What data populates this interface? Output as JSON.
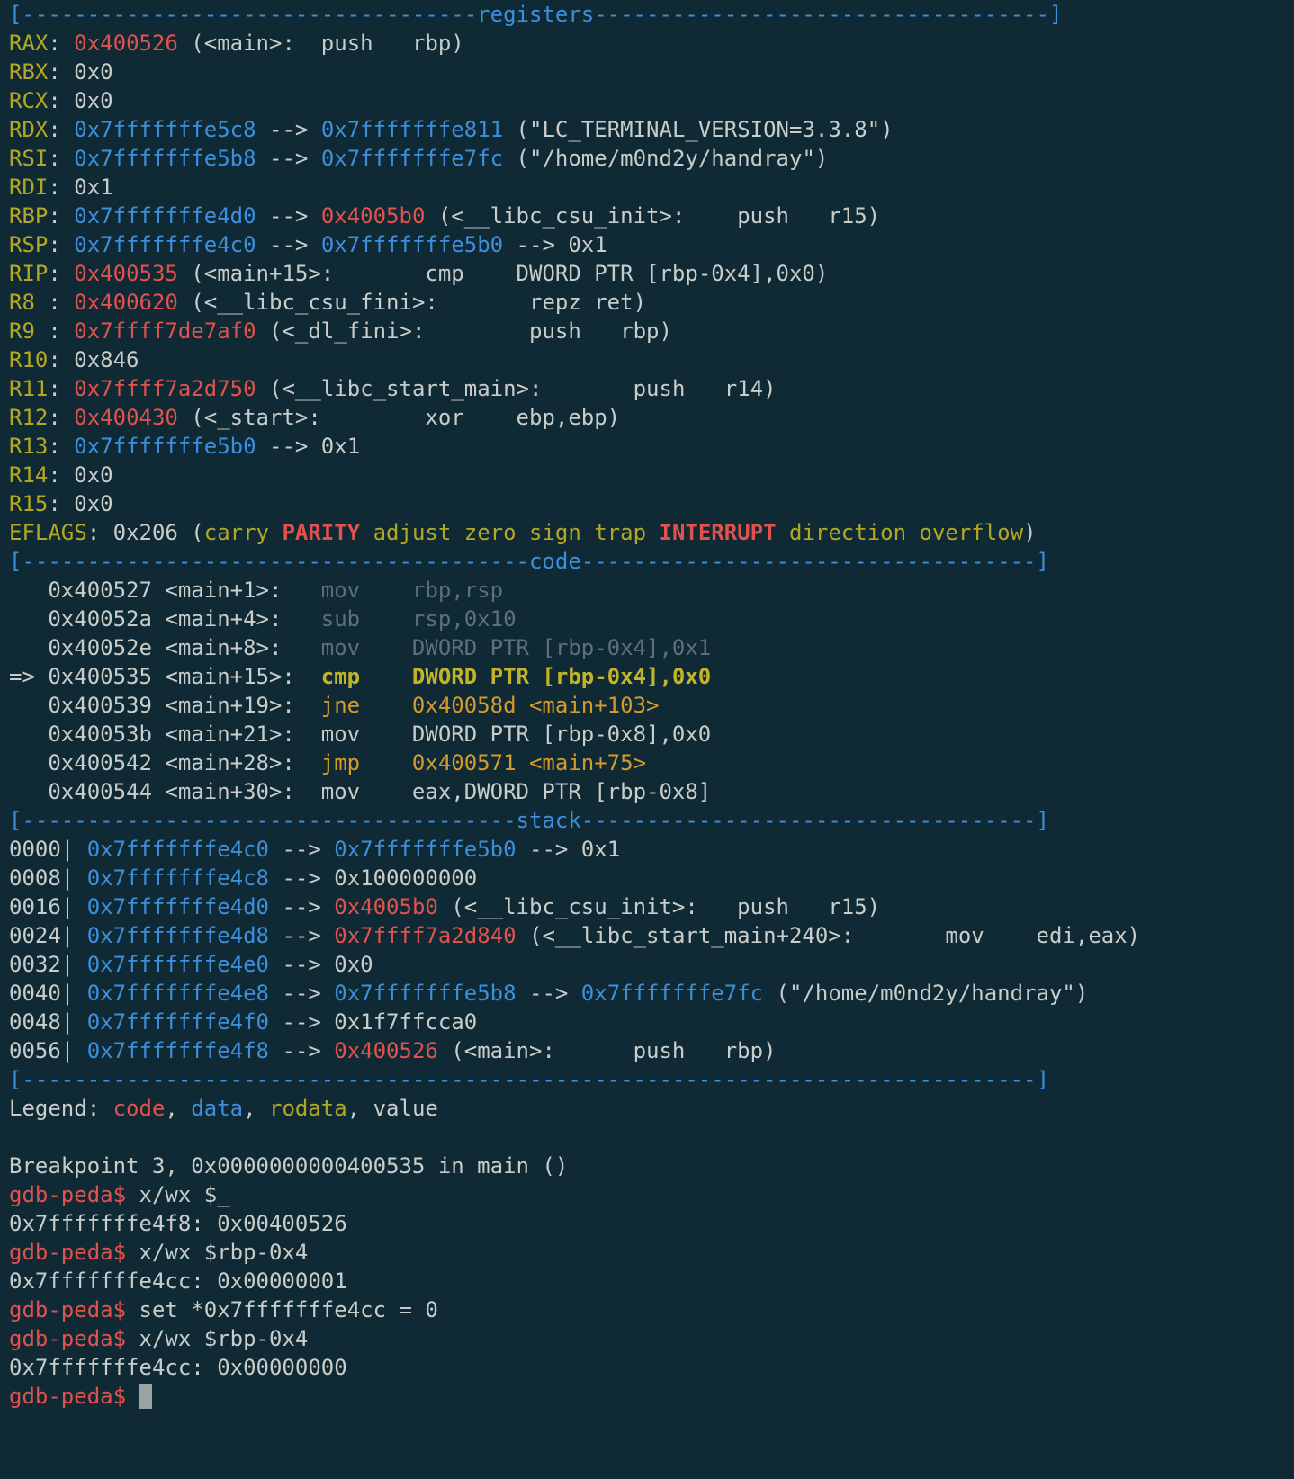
{
  "colors": {
    "background": "#0f2a35",
    "default": "#c9cdc9",
    "blue": "#3d8fdc",
    "red": "#e2524d",
    "yellow": "#b3a823",
    "orange": "#d49a2a",
    "dim": "#5c7178",
    "bright_yellow": "#c2b428",
    "cursor": "#9aa3a3"
  },
  "terminal": {
    "lines": [
      {
        "segs": [
          {
            "t": "[-----------------------------------",
            "c": "blue"
          },
          {
            "t": "registers",
            "c": "blue"
          },
          {
            "t": "-----------------------------------]",
            "c": "blue"
          }
        ]
      },
      {
        "segs": [
          {
            "t": "RAX",
            "c": "yellow"
          },
          {
            "t": ": ",
            "c": "default"
          },
          {
            "t": "0x400526",
            "c": "red"
          },
          {
            "t": " (<main>:  push   rbp)",
            "c": "default"
          }
        ]
      },
      {
        "segs": [
          {
            "t": "RBX",
            "c": "yellow"
          },
          {
            "t": ": 0x0",
            "c": "default"
          }
        ]
      },
      {
        "segs": [
          {
            "t": "RCX",
            "c": "yellow"
          },
          {
            "t": ": 0x0",
            "c": "default"
          }
        ]
      },
      {
        "segs": [
          {
            "t": "RDX",
            "c": "yellow"
          },
          {
            "t": ": ",
            "c": "default"
          },
          {
            "t": "0x7fffffffe5c8",
            "c": "blue"
          },
          {
            "t": " --> ",
            "c": "default"
          },
          {
            "t": "0x7fffffffe811",
            "c": "blue"
          },
          {
            "t": " (\"LC_TERMINAL_VERSION=3.3.8\")",
            "c": "default"
          }
        ]
      },
      {
        "segs": [
          {
            "t": "RSI",
            "c": "yellow"
          },
          {
            "t": ": ",
            "c": "default"
          },
          {
            "t": "0x7fffffffe5b8",
            "c": "blue"
          },
          {
            "t": " --> ",
            "c": "default"
          },
          {
            "t": "0x7fffffffe7fc",
            "c": "blue"
          },
          {
            "t": " (\"/home/m0nd2y/handray\")",
            "c": "default"
          }
        ]
      },
      {
        "segs": [
          {
            "t": "RDI",
            "c": "yellow"
          },
          {
            "t": ": 0x1",
            "c": "default"
          }
        ]
      },
      {
        "segs": [
          {
            "t": "RBP",
            "c": "yellow"
          },
          {
            "t": ": ",
            "c": "default"
          },
          {
            "t": "0x7fffffffe4d0",
            "c": "blue"
          },
          {
            "t": " --> ",
            "c": "default"
          },
          {
            "t": "0x4005b0",
            "c": "red"
          },
          {
            "t": " (<__libc_csu_init>:    push   r15)",
            "c": "default"
          }
        ]
      },
      {
        "segs": [
          {
            "t": "RSP",
            "c": "yellow"
          },
          {
            "t": ": ",
            "c": "default"
          },
          {
            "t": "0x7fffffffe4c0",
            "c": "blue"
          },
          {
            "t": " --> ",
            "c": "default"
          },
          {
            "t": "0x7fffffffe5b0",
            "c": "blue"
          },
          {
            "t": " --> 0x1",
            "c": "default"
          }
        ]
      },
      {
        "segs": [
          {
            "t": "RIP",
            "c": "yellow"
          },
          {
            "t": ": ",
            "c": "default"
          },
          {
            "t": "0x400535",
            "c": "red"
          },
          {
            "t": " (<main+15>:       cmp    DWORD PTR [rbp-0x4],0x0)",
            "c": "default"
          }
        ]
      },
      {
        "segs": [
          {
            "t": "R8 ",
            "c": "yellow"
          },
          {
            "t": ": ",
            "c": "default"
          },
          {
            "t": "0x400620",
            "c": "red"
          },
          {
            "t": " (<__libc_csu_fini>:       repz ret)",
            "c": "default"
          }
        ]
      },
      {
        "segs": [
          {
            "t": "R9 ",
            "c": "yellow"
          },
          {
            "t": ": ",
            "c": "default"
          },
          {
            "t": "0x7ffff7de7af0",
            "c": "red"
          },
          {
            "t": " (<_dl_fini>:        push   rbp)",
            "c": "default"
          }
        ]
      },
      {
        "segs": [
          {
            "t": "R10",
            "c": "yellow"
          },
          {
            "t": ": 0x846",
            "c": "default"
          }
        ]
      },
      {
        "segs": [
          {
            "t": "R11",
            "c": "yellow"
          },
          {
            "t": ": ",
            "c": "default"
          },
          {
            "t": "0x7ffff7a2d750",
            "c": "red"
          },
          {
            "t": " (<__libc_start_main>:       push   r14)",
            "c": "default"
          }
        ]
      },
      {
        "segs": [
          {
            "t": "R12",
            "c": "yellow"
          },
          {
            "t": ": ",
            "c": "default"
          },
          {
            "t": "0x400430",
            "c": "red"
          },
          {
            "t": " (<_start>:        xor    ebp,ebp)",
            "c": "default"
          }
        ]
      },
      {
        "segs": [
          {
            "t": "R13",
            "c": "yellow"
          },
          {
            "t": ": ",
            "c": "default"
          },
          {
            "t": "0x7fffffffe5b0",
            "c": "blue"
          },
          {
            "t": " --> 0x1",
            "c": "default"
          }
        ]
      },
      {
        "segs": [
          {
            "t": "R14",
            "c": "yellow"
          },
          {
            "t": ": 0x0",
            "c": "default"
          }
        ]
      },
      {
        "segs": [
          {
            "t": "R15",
            "c": "yellow"
          },
          {
            "t": ": 0x0",
            "c": "default"
          }
        ]
      },
      {
        "segs": [
          {
            "t": "EFLAGS",
            "c": "yellow"
          },
          {
            "t": ": 0x206 (",
            "c": "default"
          },
          {
            "t": "carry ",
            "c": "yellow"
          },
          {
            "t": "PARITY",
            "c": "red",
            "b": true
          },
          {
            "t": " adjust zero sign trap ",
            "c": "yellow"
          },
          {
            "t": "INTERRUPT",
            "c": "red",
            "b": true
          },
          {
            "t": " direction overflow",
            "c": "yellow"
          },
          {
            "t": ")",
            "c": "default"
          }
        ]
      },
      {
        "segs": [
          {
            "t": "[---------------------------------------",
            "c": "blue"
          },
          {
            "t": "code",
            "c": "blue"
          },
          {
            "t": "-----------------------------------]",
            "c": "blue"
          }
        ]
      },
      {
        "segs": [
          {
            "t": "   0x400527 <main+1>:   ",
            "c": "default"
          },
          {
            "t": "mov    rbp,rsp",
            "c": "dim"
          }
        ]
      },
      {
        "segs": [
          {
            "t": "   0x40052a <main+4>:   ",
            "c": "default"
          },
          {
            "t": "sub    rsp,0x10",
            "c": "dim"
          }
        ]
      },
      {
        "segs": [
          {
            "t": "   0x40052e <main+8>:   ",
            "c": "default"
          },
          {
            "t": "mov    DWORD PTR [rbp-0x4],0x1",
            "c": "dim"
          }
        ]
      },
      {
        "segs": [
          {
            "t": "=> 0x400535 <main+15>:  ",
            "c": "default"
          },
          {
            "t": "cmp    DWORD PTR [rbp-0x4],0x0",
            "c": "bright_yellow",
            "b": true
          }
        ]
      },
      {
        "segs": [
          {
            "t": "   0x400539 <main+19>:  ",
            "c": "default"
          },
          {
            "t": "jne    0x40058d <main+103>",
            "c": "orange"
          }
        ]
      },
      {
        "segs": [
          {
            "t": "   0x40053b <main+21>:  mov    DWORD PTR [rbp-0x8],0x0",
            "c": "default"
          }
        ]
      },
      {
        "segs": [
          {
            "t": "   0x400542 <main+28>:  ",
            "c": "default"
          },
          {
            "t": "jmp    0x400571 <main+75>",
            "c": "orange"
          }
        ]
      },
      {
        "segs": [
          {
            "t": "   0x400544 <main+30>:  mov    eax,DWORD PTR [rbp-0x8]",
            "c": "default"
          }
        ]
      },
      {
        "segs": [
          {
            "t": "[--------------------------------------",
            "c": "blue"
          },
          {
            "t": "stack",
            "c": "blue"
          },
          {
            "t": "-----------------------------------]",
            "c": "blue"
          }
        ]
      },
      {
        "segs": [
          {
            "t": "0000| ",
            "c": "default"
          },
          {
            "t": "0x7fffffffe4c0",
            "c": "blue"
          },
          {
            "t": " --> ",
            "c": "default"
          },
          {
            "t": "0x7fffffffe5b0",
            "c": "blue"
          },
          {
            "t": " --> 0x1",
            "c": "default"
          }
        ]
      },
      {
        "segs": [
          {
            "t": "0008| ",
            "c": "default"
          },
          {
            "t": "0x7fffffffe4c8",
            "c": "blue"
          },
          {
            "t": " --> 0x100000000",
            "c": "default"
          }
        ]
      },
      {
        "segs": [
          {
            "t": "0016| ",
            "c": "default"
          },
          {
            "t": "0x7fffffffe4d0",
            "c": "blue"
          },
          {
            "t": " --> ",
            "c": "default"
          },
          {
            "t": "0x4005b0",
            "c": "red"
          },
          {
            "t": " (<__libc_csu_init>:   push   r15)",
            "c": "default"
          }
        ]
      },
      {
        "segs": [
          {
            "t": "0024| ",
            "c": "default"
          },
          {
            "t": "0x7fffffffe4d8",
            "c": "blue"
          },
          {
            "t": " --> ",
            "c": "default"
          },
          {
            "t": "0x7ffff7a2d840",
            "c": "red"
          },
          {
            "t": " (<__libc_start_main+240>:       mov    edi,eax)",
            "c": "default"
          }
        ]
      },
      {
        "segs": [
          {
            "t": "0032| ",
            "c": "default"
          },
          {
            "t": "0x7fffffffe4e0",
            "c": "blue"
          },
          {
            "t": " --> 0x0",
            "c": "default"
          }
        ]
      },
      {
        "segs": [
          {
            "t": "0040| ",
            "c": "default"
          },
          {
            "t": "0x7fffffffe4e8",
            "c": "blue"
          },
          {
            "t": " --> ",
            "c": "default"
          },
          {
            "t": "0x7fffffffe5b8",
            "c": "blue"
          },
          {
            "t": " --> ",
            "c": "default"
          },
          {
            "t": "0x7fffffffe7fc",
            "c": "blue"
          },
          {
            "t": " (\"/home/m0nd2y/handray\")",
            "c": "default"
          }
        ]
      },
      {
        "segs": [
          {
            "t": "0048| ",
            "c": "default"
          },
          {
            "t": "0x7fffffffe4f0",
            "c": "blue"
          },
          {
            "t": " --> 0x1f7ffcca0",
            "c": "default"
          }
        ]
      },
      {
        "segs": [
          {
            "t": "0056| ",
            "c": "default"
          },
          {
            "t": "0x7fffffffe4f8",
            "c": "blue"
          },
          {
            "t": " --> ",
            "c": "default"
          },
          {
            "t": "0x400526",
            "c": "red"
          },
          {
            "t": " (<main>:      push   rbp)",
            "c": "default"
          }
        ]
      },
      {
        "segs": [
          {
            "t": "[------------------------------------------------------------------------------]",
            "c": "blue"
          }
        ]
      },
      {
        "segs": [
          {
            "t": "Legend: ",
            "c": "default"
          },
          {
            "t": "code",
            "c": "red"
          },
          {
            "t": ", ",
            "c": "default"
          },
          {
            "t": "data",
            "c": "blue"
          },
          {
            "t": ", ",
            "c": "default"
          },
          {
            "t": "rodata",
            "c": "yellow"
          },
          {
            "t": ", value",
            "c": "default"
          }
        ]
      },
      {
        "segs": []
      },
      {
        "segs": [
          {
            "t": "Breakpoint 3, 0x0000000000400535 in main ()",
            "c": "default"
          }
        ]
      },
      {
        "segs": [
          {
            "t": "gdb-peda$ ",
            "c": "red"
          },
          {
            "t": "x/wx $_",
            "c": "default"
          }
        ]
      },
      {
        "segs": [
          {
            "t": "0x7fffffffe4f8: 0x00400526",
            "c": "default"
          }
        ]
      },
      {
        "segs": [
          {
            "t": "gdb-peda$ ",
            "c": "red"
          },
          {
            "t": "x/wx $rbp-0x4",
            "c": "default"
          }
        ]
      },
      {
        "segs": [
          {
            "t": "0x7fffffffe4cc: 0x00000001",
            "c": "default"
          }
        ]
      },
      {
        "segs": [
          {
            "t": "gdb-peda$ ",
            "c": "red"
          },
          {
            "t": "set *0x7fffffffe4cc = 0",
            "c": "default"
          }
        ]
      },
      {
        "segs": [
          {
            "t": "gdb-peda$ ",
            "c": "red"
          },
          {
            "t": "x/wx $rbp-0x4",
            "c": "default"
          }
        ]
      },
      {
        "segs": [
          {
            "t": "0x7fffffffe4cc: 0x00000000",
            "c": "default"
          }
        ]
      },
      {
        "segs": [
          {
            "t": "gdb-peda$ ",
            "c": "red"
          }
        ],
        "cursor": true
      }
    ]
  }
}
